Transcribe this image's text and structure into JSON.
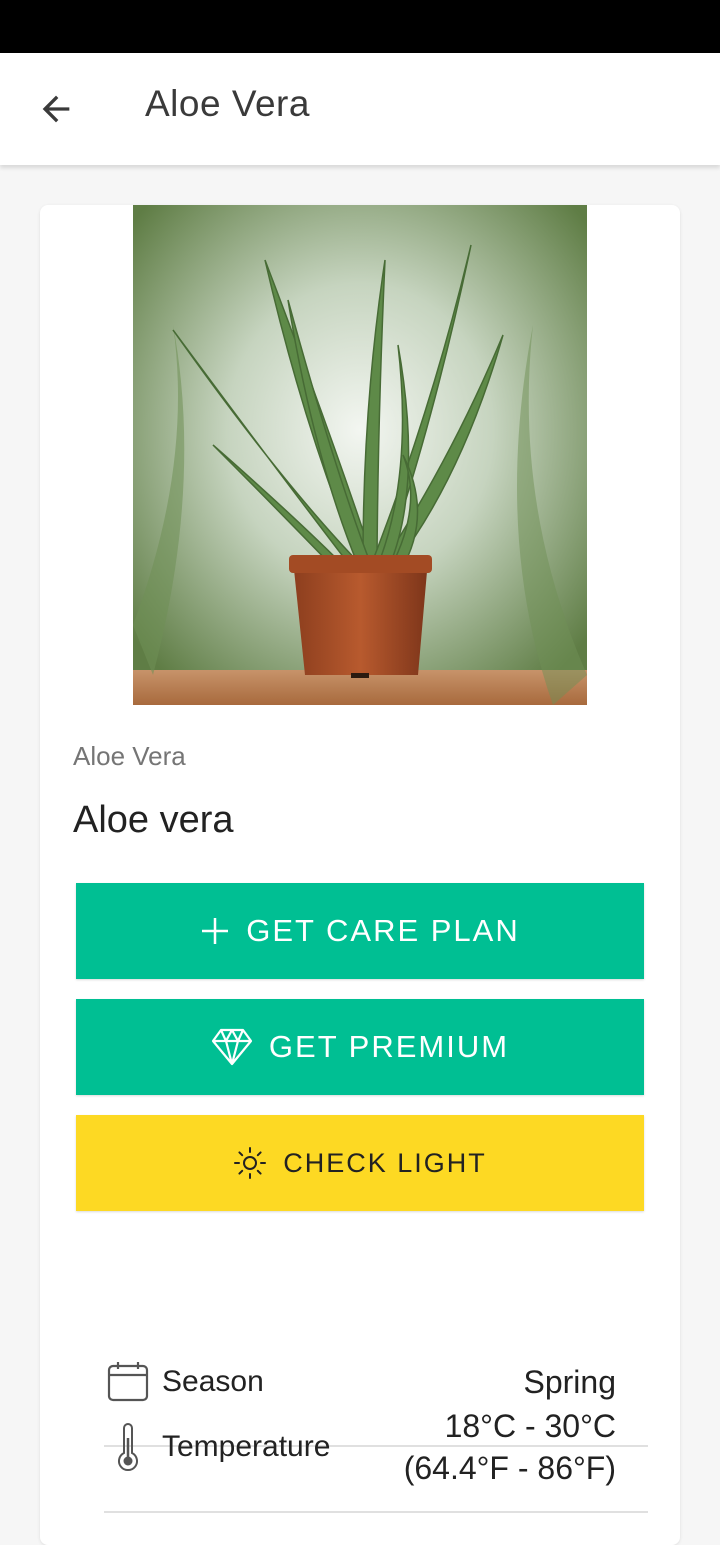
{
  "app_bar": {
    "title": "Aloe Vera"
  },
  "plant": {
    "common_name": "Aloe Vera",
    "scientific_name": "Aloe vera"
  },
  "buttons": {
    "care_plan": "GET CARE PLAN",
    "premium": "GET PREMIUM",
    "check_light": "CHECK LIGHT"
  },
  "details": {
    "season_label": "Season",
    "season_value": "Spring",
    "temperature_label": "Temperature",
    "temperature_celsius": "18°C - 30°C",
    "temperature_fahrenheit": "(64.4°F - 86°F)"
  },
  "colors": {
    "primary": "#00bf93",
    "warning": "#fdd923"
  },
  "icons": [
    "back-arrow-icon",
    "plus-icon",
    "diamond-icon",
    "sun-icon",
    "calendar-icon",
    "thermometer-icon"
  ]
}
